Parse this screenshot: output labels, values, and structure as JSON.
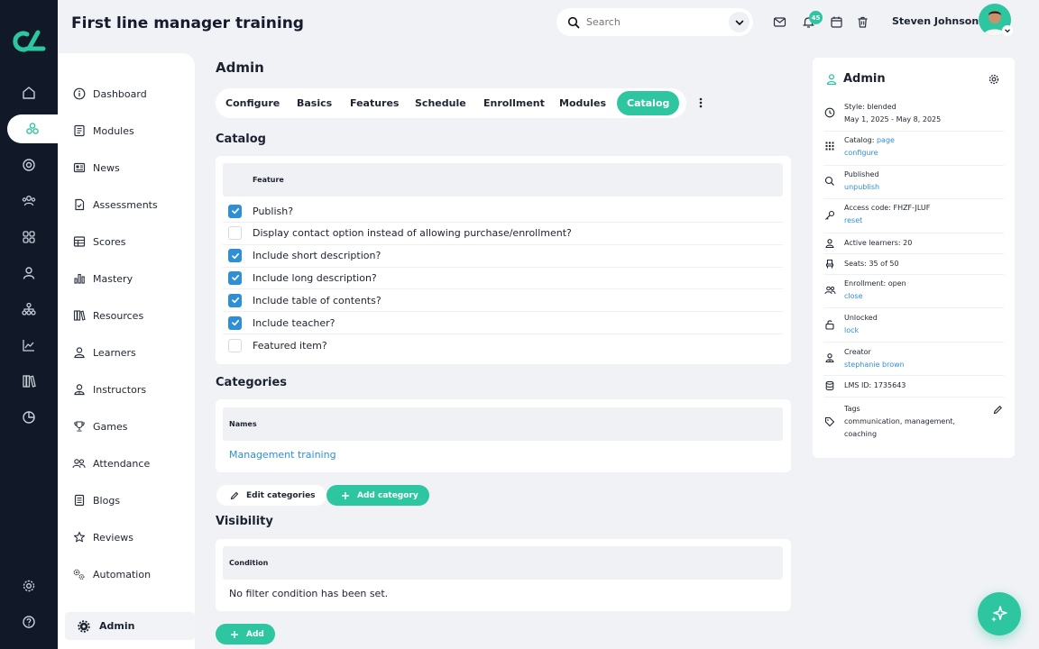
{
  "header": {
    "title": "First line manager training",
    "search_placeholder": "Search",
    "notification_count": "45",
    "user_name": "Steven Johnson"
  },
  "colors": {
    "accent": "#2ec6a0",
    "link": "#2e8fd6",
    "rail": "#111827"
  },
  "rail_icons": [
    "home-icon",
    "modules-icon",
    "target-icon",
    "users-icon",
    "grid-icon",
    "user-icon",
    "network-icon",
    "chart-line-icon",
    "books-icon",
    "pie-chart-icon",
    "gear-icon",
    "help-icon"
  ],
  "sidebar": {
    "items": [
      {
        "label": "Dashboard",
        "icon": "info-circle-icon"
      },
      {
        "label": "Modules",
        "icon": "document-list-icon"
      },
      {
        "label": "News",
        "icon": "newspaper-icon"
      },
      {
        "label": "Assessments",
        "icon": "clipboard-check-icon"
      },
      {
        "label": "Scores",
        "icon": "table-icon"
      },
      {
        "label": "Mastery",
        "icon": "bar-chart-icon"
      },
      {
        "label": "Resources",
        "icon": "books-icon"
      },
      {
        "label": "Learners",
        "icon": "person-icon"
      },
      {
        "label": "Instructors",
        "icon": "instructor-icon"
      },
      {
        "label": "Games",
        "icon": "trophy-icon"
      },
      {
        "label": "Attendance",
        "icon": "people-icon"
      },
      {
        "label": "Blogs",
        "icon": "document-icon"
      },
      {
        "label": "Reviews",
        "icon": "star-icon"
      },
      {
        "label": "Automation",
        "icon": "gears-icon"
      }
    ],
    "admin_label": "Admin"
  },
  "main": {
    "heading": "Admin",
    "tabs": [
      {
        "label": "Configure"
      },
      {
        "label": "Basics"
      },
      {
        "label": "Features"
      },
      {
        "label": "Schedule"
      },
      {
        "label": "Enrollment"
      },
      {
        "label": "Modules"
      },
      {
        "label": "Catalog"
      }
    ],
    "active_tab": "Catalog",
    "catalog": {
      "title": "Catalog",
      "column_header": "Feature",
      "rows": [
        {
          "label": "Publish?",
          "checked": true
        },
        {
          "label": "Display contact option instead of allowing purchase/enrollment?",
          "checked": false
        },
        {
          "label": "Include short description?",
          "checked": true
        },
        {
          "label": "Include long description?",
          "checked": true
        },
        {
          "label": "Include table of contents?",
          "checked": true
        },
        {
          "label": "Include teacher?",
          "checked": true
        },
        {
          "label": "Featured item?",
          "checked": false
        }
      ]
    },
    "categories": {
      "title": "Categories",
      "column_header": "Names",
      "items": [
        "Management training"
      ],
      "edit_button": "Edit categories",
      "add_button": "Add category"
    },
    "visibility": {
      "title": "Visibility",
      "column_header": "Condition",
      "empty_text": "No filter condition has been set.",
      "add_button": "Add"
    }
  },
  "panel": {
    "title": "Admin",
    "rows": [
      {
        "icon": "clock-icon",
        "line1": "Style: blended",
        "line2": "May 1, 2025 - May 8, 2025"
      },
      {
        "icon": "grid-dots-icon",
        "line1_prefix": "Catalog: ",
        "line1_link": "page",
        "line2_link": "configure"
      },
      {
        "icon": "search-icon",
        "line1": "Published",
        "line2_link": "unpublish"
      },
      {
        "icon": "key-icon",
        "line1": "Access code: FHZF-JLUF",
        "line2_link": "reset"
      },
      {
        "icon": "person-icon",
        "line1": "Active learners: 20"
      },
      {
        "icon": "seat-icon",
        "line1": "Seats: 35 of 50"
      },
      {
        "icon": "people-icon",
        "line1": "Enrollment: open",
        "line2_link": "close"
      },
      {
        "icon": "unlock-icon",
        "line1": "Unlocked",
        "line2_link": "lock"
      },
      {
        "icon": "creator-icon",
        "line1": "Creator",
        "line2_link": "stephanie brown"
      },
      {
        "icon": "database-icon",
        "line1": "LMS ID: 1735643"
      },
      {
        "icon": "tag-icon",
        "line1": "Tags",
        "line2": "communication, management,",
        "line3": "coaching"
      }
    ]
  }
}
